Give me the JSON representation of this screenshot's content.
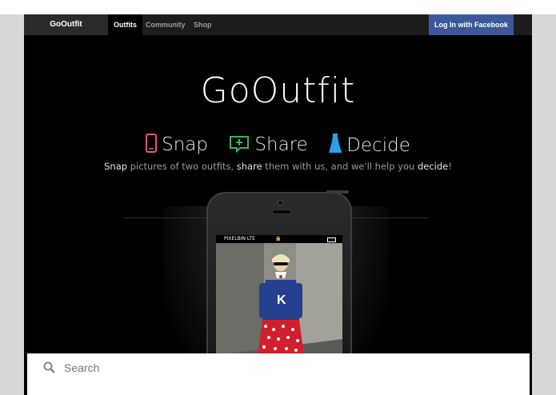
{
  "nav": {
    "brand": "GoOutfit",
    "links": [
      "Outfits",
      "Community",
      "Shop"
    ],
    "login_label": "Log In with Facebook"
  },
  "hero": {
    "title": "GoOutfit",
    "features": [
      {
        "label": "Snap",
        "icon": "phone-icon",
        "color": "#e4537c"
      },
      {
        "label": "Share",
        "icon": "share-icon",
        "color": "#3bb35a"
      },
      {
        "label": "Decide",
        "icon": "dress-icon",
        "color": "#2aa3ec"
      }
    ],
    "tagline": {
      "part1": "Snap",
      "part2": " pictures of two outfits, ",
      "part3": "share",
      "part4": " them with us, and we'll help you ",
      "part5": "decide",
      "part6": "!"
    }
  },
  "phone": {
    "carrier": "PIXELBIN  LTE"
  },
  "search": {
    "placeholder": "Search"
  },
  "colors": {
    "facebook": "#3b5998",
    "background": "#000000",
    "nav": "#1c1c1c"
  }
}
